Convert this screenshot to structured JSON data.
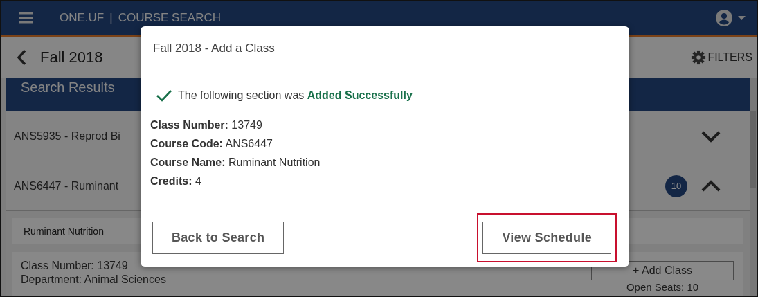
{
  "header": {
    "app_name": "ONE.UF",
    "separator": "|",
    "section": "COURSE SEARCH"
  },
  "term_bar": {
    "term": "Fall 2018",
    "filters_label": "FILTERS"
  },
  "results": {
    "heading": "Search Results",
    "courses": [
      {
        "title": "ANS5935 - Reprod Bi",
        "expanded": false
      },
      {
        "title": "ANS6447 - Ruminant",
        "expanded": true,
        "badge": "10"
      }
    ]
  },
  "section_detail": {
    "course_name": "Ruminant Nutrition",
    "lines": [
      "Class Number: 13749",
      "Department: Animal Sciences"
    ],
    "add_button": "+ Add Class",
    "open_seats": "Open Seats: 10"
  },
  "dialog": {
    "title": "Fall 2018 - Add a Class",
    "message": "The following section was **Added Successfully**",
    "fields": [
      {
        "label": "Class Number:",
        "value": "13749"
      },
      {
        "label": "Course Code:",
        "value": "ANS6447"
      },
      {
        "label": "Course Name:",
        "value": "Ruminant Nutrition"
      },
      {
        "label": "Credits:",
        "value": "4"
      }
    ],
    "buttons": [
      {
        "label": "Back to Search",
        "highlighted": false
      },
      {
        "label": "View Schedule",
        "highlighted": true
      }
    ]
  }
}
